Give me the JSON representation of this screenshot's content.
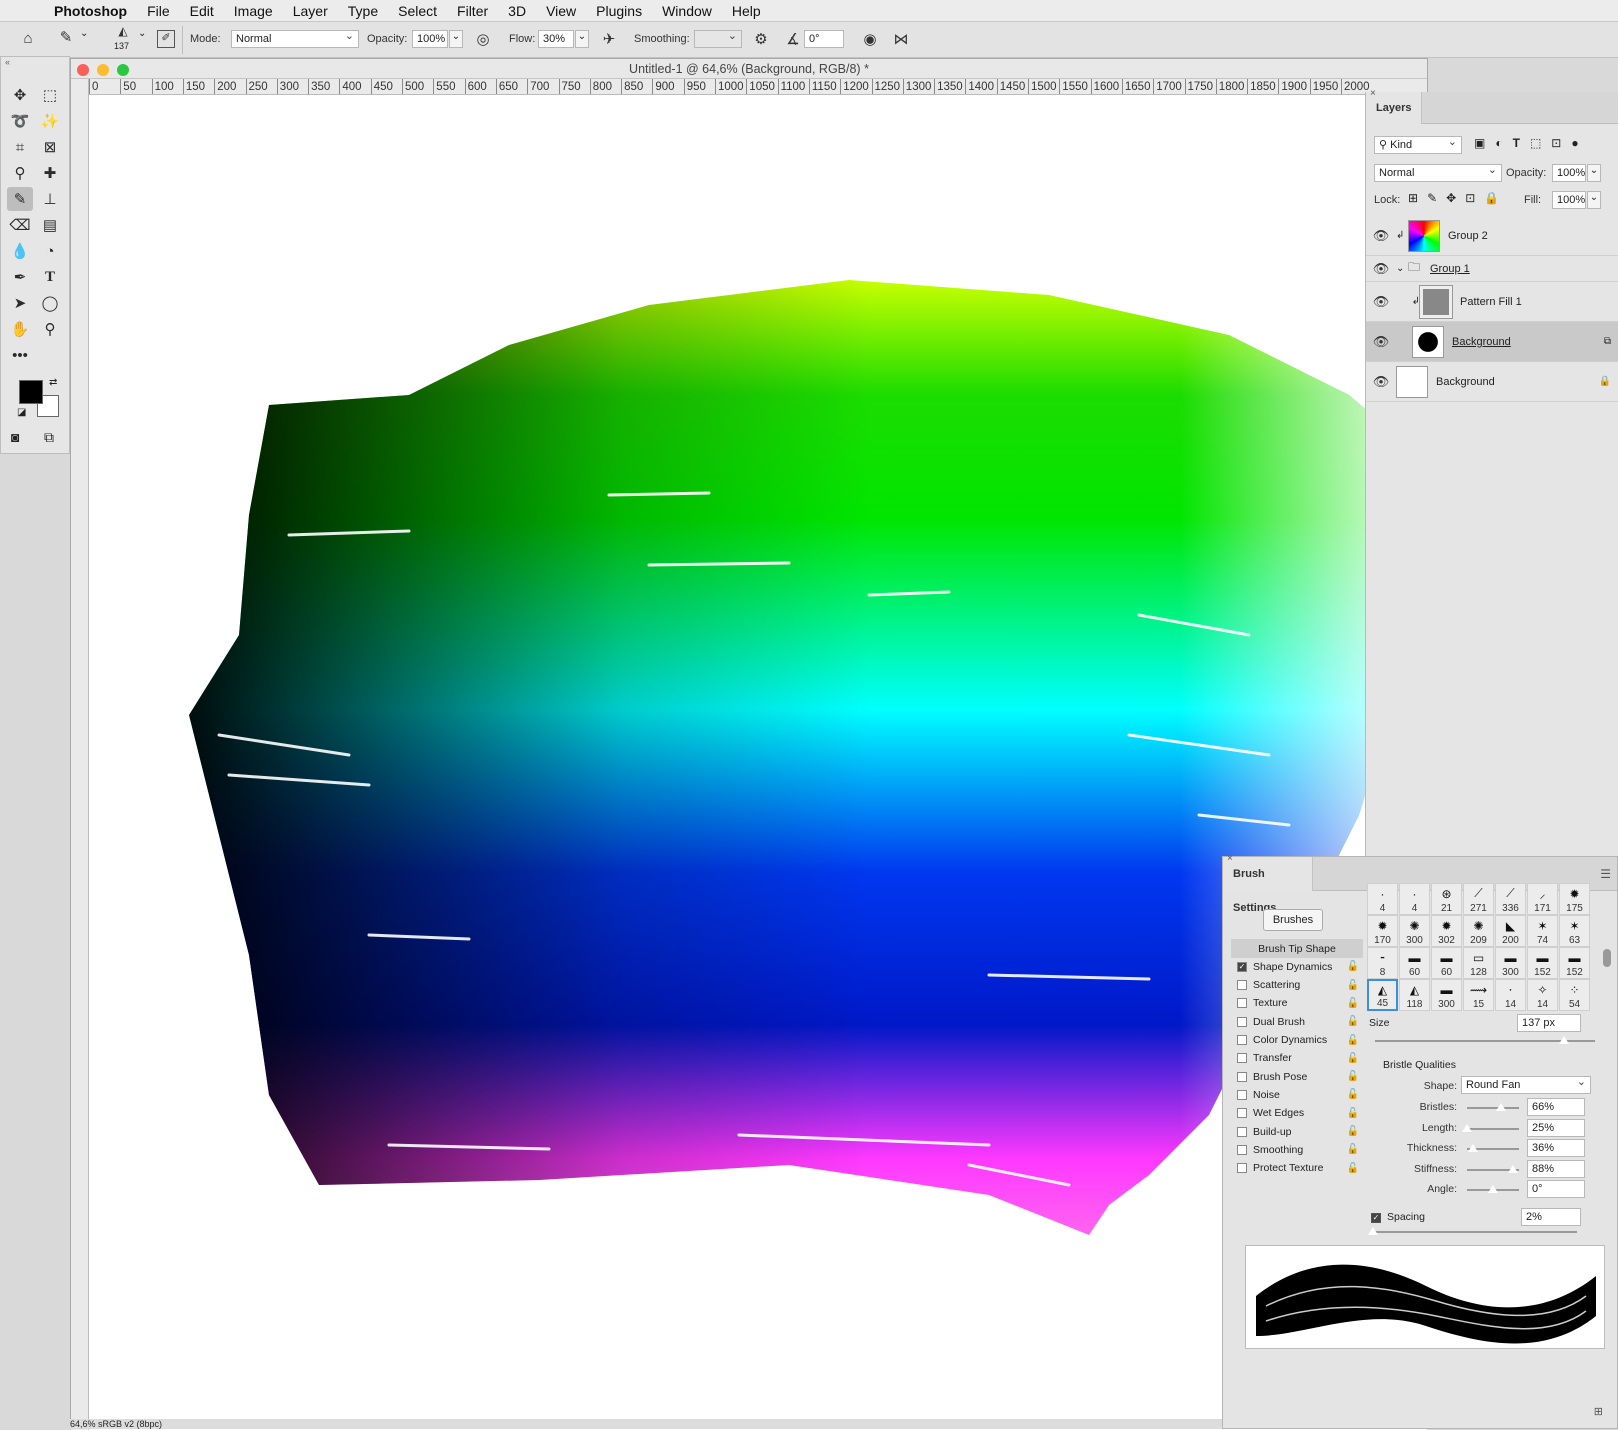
{
  "menu": {
    "items": [
      "Photoshop",
      "File",
      "Edit",
      "Image",
      "Layer",
      "Type",
      "Select",
      "Filter",
      "3D",
      "View",
      "Plugins",
      "Window",
      "Help"
    ]
  },
  "options": {
    "brush_size": "137",
    "mode_label": "Mode:",
    "mode_value": "Normal",
    "opacity_label": "Opacity:",
    "opacity_value": "100%",
    "flow_label": "Flow:",
    "flow_value": "30%",
    "smoothing_label": "Smoothing:",
    "smoothing_value": "",
    "angle_value": "0°"
  },
  "document": {
    "title": "Untitled-1 @ 64,6% (Background, RGB/8) *",
    "ruler_labels": [
      "0",
      "50",
      "100",
      "150",
      "200",
      "250",
      "300",
      "350",
      "400",
      "450",
      "500",
      "550",
      "600",
      "650",
      "700",
      "750",
      "800",
      "850",
      "900",
      "950",
      "1000",
      "1050",
      "1100",
      "1150",
      "1200",
      "1250",
      "1300",
      "1350",
      "1400",
      "1450",
      "1500",
      "1550",
      "1600",
      "1650",
      "1700",
      "1750",
      "1800",
      "1850",
      "1900",
      "1950",
      "2000"
    ],
    "status": "64,6%   sRGB v2 (8bpc)"
  },
  "layers": {
    "tab": "Layers",
    "filter_kind": "Kind",
    "blend_mode": "Normal",
    "opacity_label": "Opacity:",
    "opacity_value": "100%",
    "lock_label": "Lock:",
    "fill_label": "Fill:",
    "fill_value": "100%",
    "rows": [
      {
        "name": "Group 2"
      },
      {
        "name": "Group 1"
      },
      {
        "name": "Pattern Fill 1"
      },
      {
        "name": "Background"
      },
      {
        "name": "Background"
      }
    ]
  },
  "brush": {
    "tab": "Brush Settings",
    "brushes_button": "Brushes",
    "options": [
      {
        "label": "Brush Tip Shape",
        "checked": false
      },
      {
        "label": "Shape Dynamics",
        "checked": true
      },
      {
        "label": "Scattering",
        "checked": false
      },
      {
        "label": "Texture",
        "checked": false
      },
      {
        "label": "Dual Brush",
        "checked": false
      },
      {
        "label": "Color Dynamics",
        "checked": false
      },
      {
        "label": "Transfer",
        "checked": false
      },
      {
        "label": "Brush Pose",
        "checked": false
      },
      {
        "label": "Noise",
        "checked": false
      },
      {
        "label": "Wet Edges",
        "checked": false
      },
      {
        "label": "Build-up",
        "checked": false
      },
      {
        "label": "Smoothing",
        "checked": false
      },
      {
        "label": "Protect Texture",
        "checked": false
      }
    ],
    "presets": [
      "4",
      "4",
      "21",
      "271",
      "336",
      "171",
      "175",
      "170",
      "300",
      "302",
      "209",
      "200",
      "74",
      "63",
      "8",
      "60",
      "60",
      "128",
      "300",
      "152",
      "152",
      "45",
      "118",
      "300",
      "15",
      "14",
      "14",
      "54"
    ],
    "size_label": "Size",
    "size_value": "137 px",
    "size_fraction": 0.86,
    "bristle_title": "Bristle Qualities",
    "shape_label": "Shape:",
    "shape_value": "Round Fan",
    "params": [
      {
        "label": "Bristles:",
        "value": "66%",
        "pos": 0.66
      },
      {
        "label": "Length:",
        "value": "25%",
        "pos": 0.0
      },
      {
        "label": "Thickness:",
        "value": "36%",
        "pos": 0.12
      },
      {
        "label": "Stiffness:",
        "value": "88%",
        "pos": 0.88
      },
      {
        "label": "Angle:",
        "value": "0°",
        "pos": 0.5
      }
    ],
    "spacing_label": "Spacing",
    "spacing_value": "2%",
    "spacing_fraction": 0.0
  }
}
